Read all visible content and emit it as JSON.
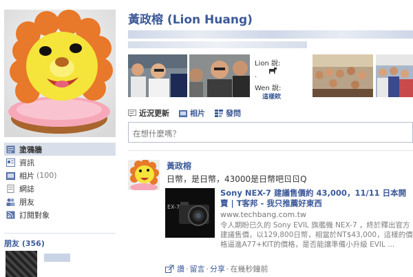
{
  "profile": {
    "name": "黃政榕 (Lion Huang)"
  },
  "sidebar": {
    "items": [
      {
        "label": "塗鴉牆",
        "icon": "wall-icon",
        "active": true
      },
      {
        "label": "資訊",
        "icon": "info-icon"
      },
      {
        "label": "相片",
        "count": "(100)",
        "icon": "photos-icon"
      },
      {
        "label": "網誌",
        "icon": "notes-icon"
      },
      {
        "label": "朋友",
        "icon": "friends-icon"
      },
      {
        "label": "訂閱對象",
        "icon": "subscriptions-icon"
      }
    ],
    "friends_header": "朋友 (356)"
  },
  "photostrip": {
    "lion_says": "Lion 說:",
    "wen_says": "Wen 說:",
    "wen_reply": "這樣欸"
  },
  "wall_tabs": [
    {
      "label": "近況更新",
      "icon": "status-icon"
    },
    {
      "label": "相片",
      "icon": "photo-icon"
    },
    {
      "label": "發問",
      "icon": "question-icon"
    }
  ],
  "status_box": {
    "placeholder": "在想什麼嗎？"
  },
  "post": {
    "author": "黃政榕",
    "text": "日幣，是日幣，43000是日幣吧ㄖㄖQ",
    "link": {
      "title": "Sony NEX-7 建議售價約 43,000，11/11 日本開賣 | T客邦 - 我只推薦好東西",
      "url": "www.techbang.com.tw",
      "description": "令人期盼已久的 Sony EVIL 旗艦機 NEX-7 ，終於釋出官方建議售價，以129,800日幣，相當於NT$43,000，這樣的價格逼進A77+KIT的價格，是否能讓準備小升級 EVIL ..."
    },
    "actions": {
      "like": "讚",
      "comment": "留言",
      "share": "分享",
      "time": "在幾秒鐘前"
    }
  },
  "colors": {
    "link_blue": "#3b5998",
    "nav_active_bg": "#d8dfea"
  }
}
